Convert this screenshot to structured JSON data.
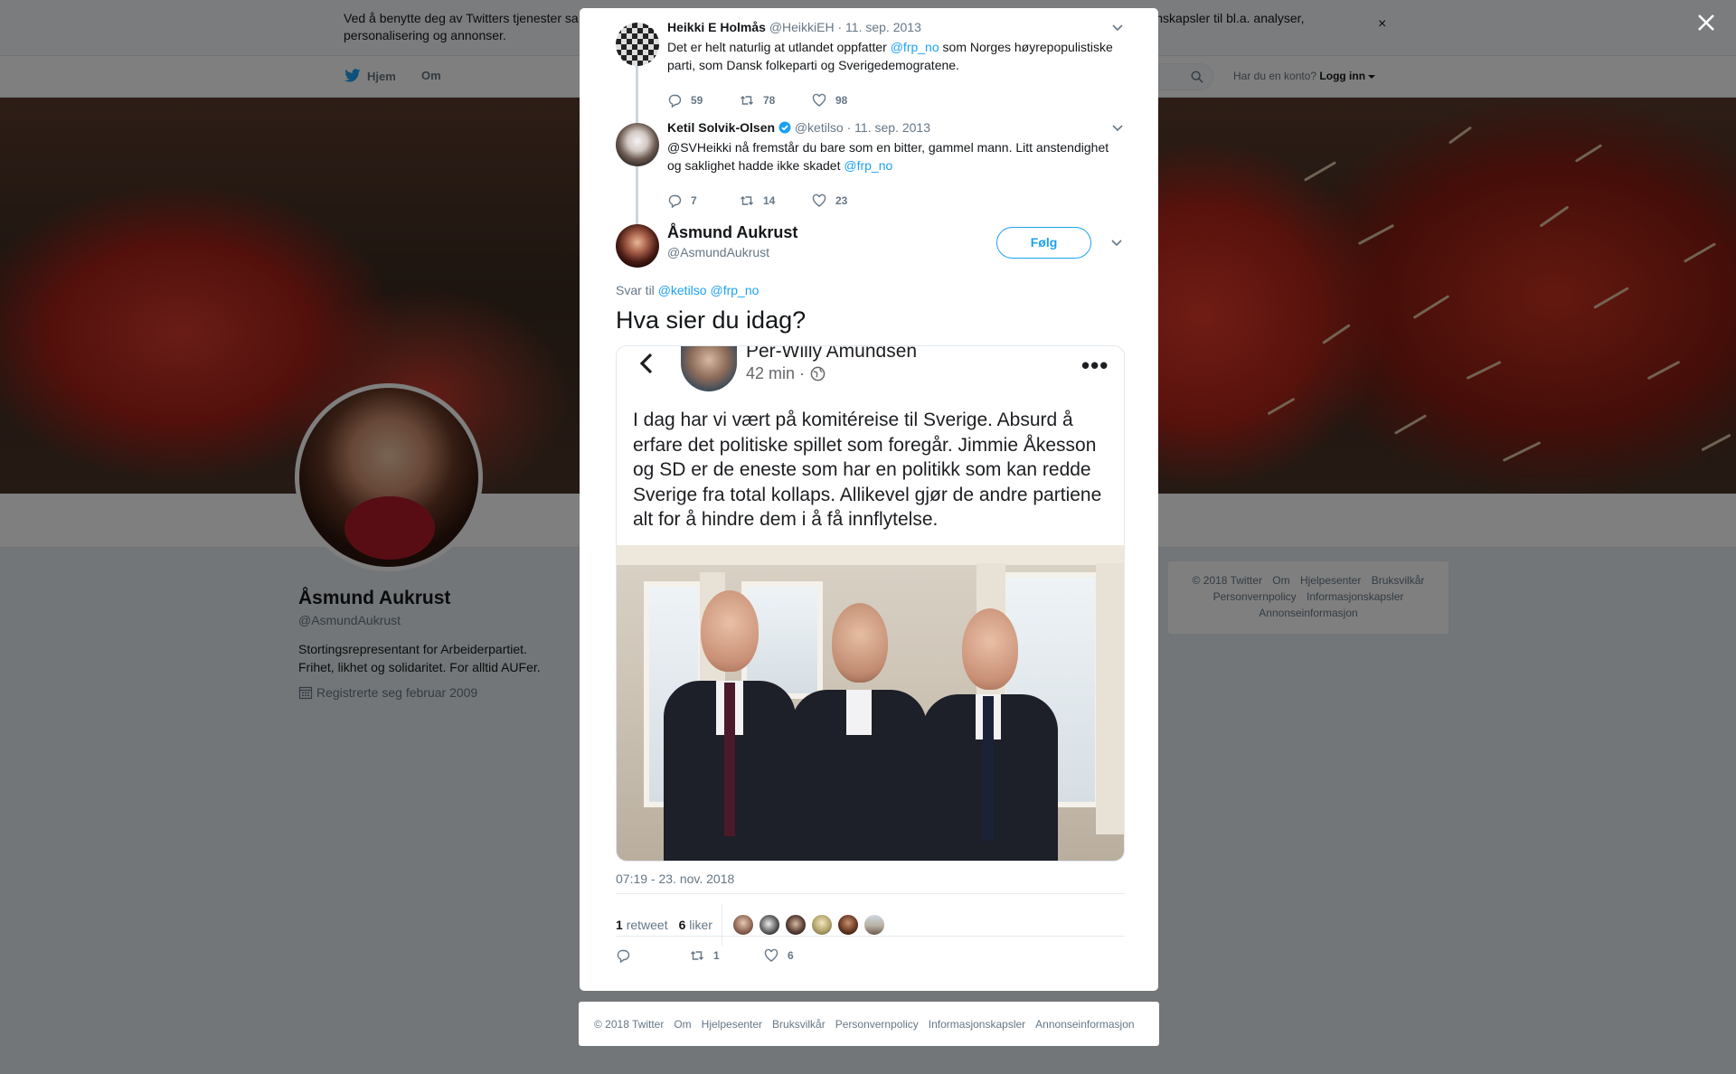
{
  "cookie_banner": {
    "text": "Ved å benytte deg av Twitters tjenester sa                                                                                                                                                                                     informasjonskapsler til bl.a. analyser, personalisering og annonser.",
    "text_left": "Ved å benytte deg av Twitters tjenester sa",
    "text_right": "informasjonskapsler til bl.a. analyser,",
    "text_line2": "personalisering og annonser.",
    "close": "×"
  },
  "nav": {
    "home": "Hjem",
    "about": "Om",
    "have_account": "Har du en konto?",
    "login": "Logg inn"
  },
  "profile": {
    "name": "Åsmund Aukrust",
    "handle": "@AsmundAukrust",
    "bio_line1": "Stortingsrepresentant for Arbeiderpartiet.",
    "bio_line2": "Frihet, likhet og solidaritet. For alltid AUFer.",
    "joined": "Registrerte seg februar 2009"
  },
  "side_footer": {
    "items": [
      "© 2018 Twitter",
      "Om",
      "Hjelpesenter",
      "Bruksvilkår",
      "Personvernpolicy",
      "Informasjonskapsler",
      "Annonseinformasjon"
    ]
  },
  "thread": [
    {
      "name": "Heikki E Holmås",
      "handle": "@HeikkiEH",
      "date": "· 11. sep. 2013",
      "text_pre": "Det er helt naturlig at utlandet oppfatter ",
      "mention": "@frp_no",
      "text_post": " som Norges høyrepopulistiske parti, som Dansk folkeparti og Sverigedemogratene.",
      "replies": "59",
      "retweets": "78",
      "likes": "98"
    },
    {
      "name": "Ketil Solvik-Olsen",
      "handle": "@ketilso",
      "date": "· 11. sep. 2013",
      "text_pre": "@SVHeikki nå fremstår du bare som en bitter, gammel mann. Litt anstendighet og saklighet hadde ikke skadet ",
      "mention": "@frp_no",
      "text_post": "",
      "replies": "7",
      "retweets": "14",
      "likes": "23"
    }
  ],
  "main_tweet": {
    "name": "Åsmund Aukrust",
    "handle": "@AsmundAukrust",
    "follow": "Følg",
    "reply_label": "Svar til",
    "reply_mention1": "@ketilso",
    "reply_mention2": "@frp_no",
    "text": "Hva sier du idag?",
    "timestamp": "07:19 - 23. nov. 2018",
    "retweet_count": "1",
    "retweet_label": "retweet",
    "like_count": "6",
    "like_label": "liker",
    "action_retweets": "1",
    "action_likes": "6"
  },
  "media": {
    "fb_name": "Per-Willy Amundsen",
    "fb_time": "42 min ·",
    "fb_post": "I dag har vi vært på komitéreise til Sverige. Absurd å erfare det politiske spillet som foregår. Jimmie Åkesson og SD er de eneste som har en politikk som kan redde Sverige fra total kollaps. Allikevel gjør de andre partiene alt for å hindre dem i å få innflytelse."
  },
  "modal_footer": {
    "items": [
      "© 2018 Twitter",
      "Om",
      "Hjelpesenter",
      "Bruksvilkår",
      "Personvernpolicy",
      "Informasjonskapsler",
      "Annonseinformasjon"
    ]
  },
  "colors": {
    "accent": "#1da1f2",
    "muted": "#657786",
    "text": "#14171a",
    "overlay": "rgba(0,0,0,0.5)"
  },
  "icons": {
    "reply": "reply-icon",
    "retweet": "retweet-icon",
    "like": "heart-icon",
    "verified": "verified-badge-icon",
    "close": "close-icon",
    "chevron": "chevron-down-icon",
    "search": "search-icon",
    "calendar": "calendar-icon",
    "bird": "twitter-bird-icon"
  }
}
